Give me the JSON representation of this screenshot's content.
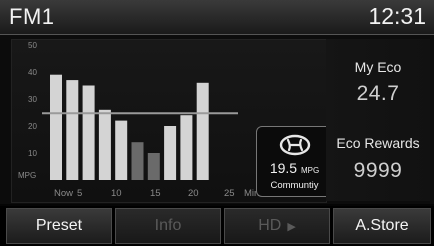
{
  "header": {
    "source": "FM1",
    "clock": "12:31"
  },
  "eco": {
    "my_eco_label": "My Eco",
    "my_eco_value": "24.7",
    "rewards_label": "Eco Rewards",
    "rewards_value": "9999"
  },
  "community": {
    "icon": "hyundai-logo-icon",
    "mpg_value": "19.5",
    "mpg_unit": "MPG",
    "label": "Communtiy"
  },
  "buttons": {
    "preset": "Preset",
    "info": "Info",
    "hd": "HD",
    "hd_icon": "play-arrow-icon",
    "astore": "A.Store"
  },
  "chart_data": {
    "type": "bar",
    "ylabel": "MPG",
    "xlabel": "Minutes Past",
    "ylim": [
      0,
      50
    ],
    "yticks": [
      10,
      20,
      30,
      40,
      50
    ],
    "categories": [
      "Now",
      "",
      "5",
      "",
      "10",
      "",
      "15",
      "",
      "20",
      "",
      "25"
    ],
    "x_tick_labels": [
      "Now",
      "5",
      "10",
      "15",
      "20",
      "25"
    ],
    "values": [
      39,
      37,
      35,
      26,
      22,
      14,
      10,
      20,
      24,
      36
    ],
    "reference_line": 24.7,
    "grid": false,
    "colors": {
      "bar_light": "#d4d4d4",
      "bar_dark": "#6a6a6a",
      "reference_line": "#9a9a9a",
      "axis_text": "#8a8a8a"
    }
  }
}
